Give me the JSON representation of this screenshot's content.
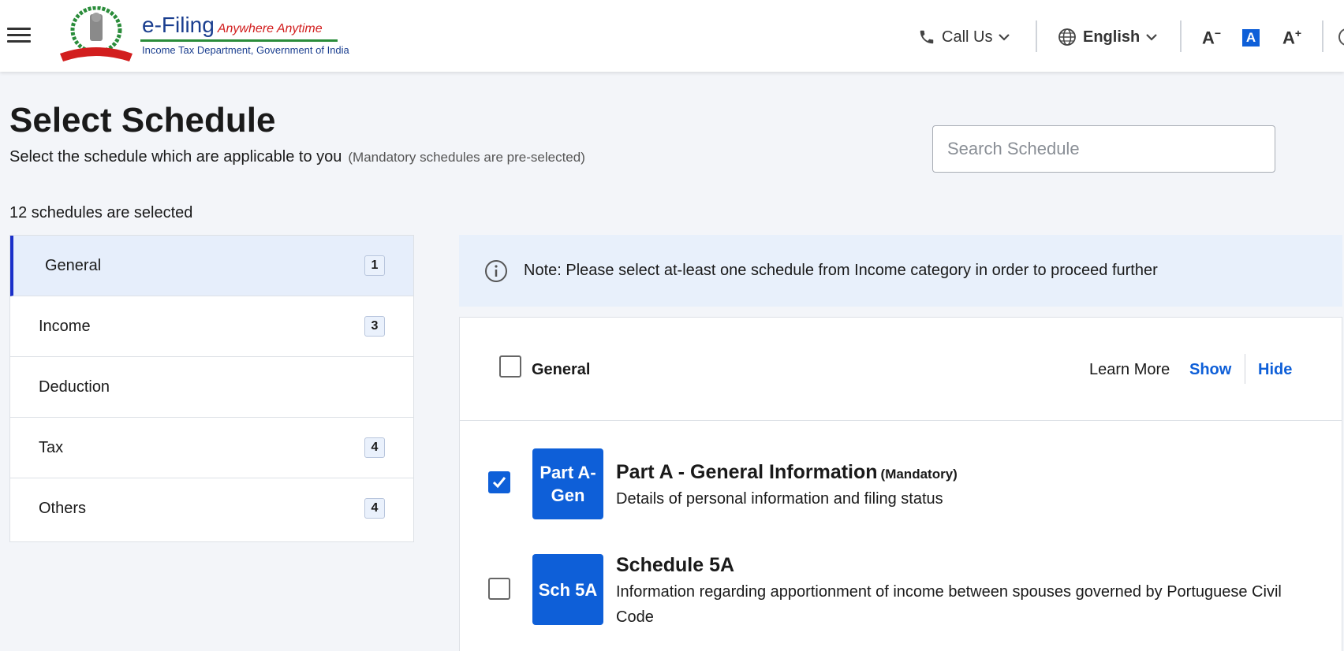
{
  "header": {
    "logo_title": "e-Filing",
    "logo_tagline": "Anywhere Anytime",
    "logo_subtitle": "Income Tax Department, Government of India",
    "call_us": "Call Us",
    "language": "English",
    "font_decrease": "A",
    "font_normal": "A",
    "font_increase": "A"
  },
  "page": {
    "title": "Select Schedule",
    "subtitle": "Select the schedule which are applicable to you",
    "subtitle_note": "(Mandatory schedules are pre-selected)",
    "search_placeholder": "Search Schedule",
    "selected_count_text": "12 schedules are selected"
  },
  "sidebar": {
    "items": [
      {
        "label": "General",
        "count": "1",
        "active": true
      },
      {
        "label": "Income",
        "count": "3"
      },
      {
        "label": "Deduction",
        "count": ""
      },
      {
        "label": "Tax",
        "count": "4"
      },
      {
        "label": "Others",
        "count": "4"
      }
    ]
  },
  "note": {
    "text": "Note: Please select at-least one schedule from Income category in order to proceed further"
  },
  "panel": {
    "category_label": "General",
    "learn_more": "Learn More",
    "show": "Show",
    "hide": "Hide",
    "schedules": [
      {
        "code": "Part A-Gen",
        "title": "Part A - General Information",
        "tag": "(Mandatory)",
        "description": "Details of personal information and filing status",
        "checked": true
      },
      {
        "code": "Sch 5A",
        "title": "Schedule 5A",
        "tag": "",
        "description": "Information regarding apportionment of income between spouses governed by Portuguese Civil Code",
        "checked": false
      }
    ]
  },
  "colors": {
    "accent": "#0e5fd8",
    "active_bar": "#1a2fc9",
    "note_bg": "#e8f0fb",
    "page_bg": "#f3f5f9"
  }
}
